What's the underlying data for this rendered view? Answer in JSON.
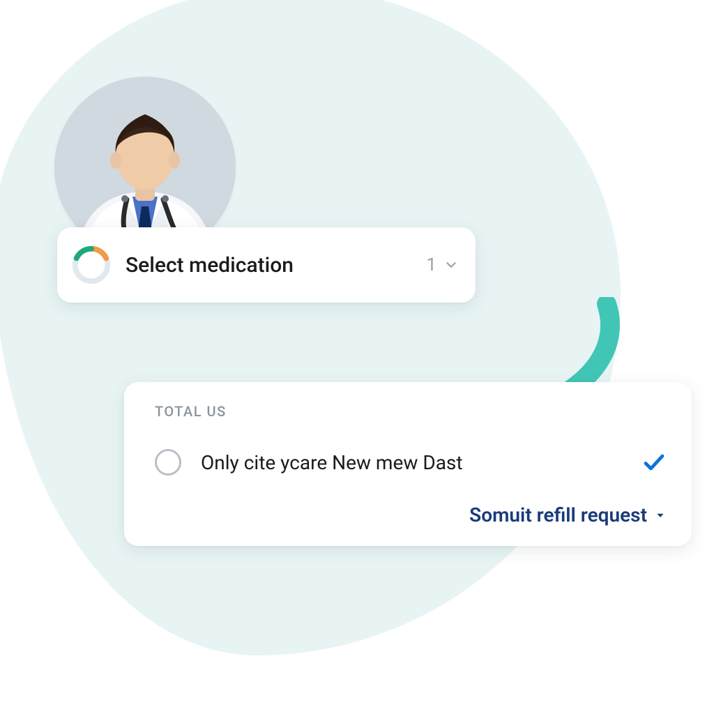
{
  "medication_selector": {
    "label": "Select medication",
    "count": "1"
  },
  "result_card": {
    "header": "TOTAL US",
    "option_label": "Only cite ycare New mew Dast",
    "action_label": "Somuit refill request"
  }
}
